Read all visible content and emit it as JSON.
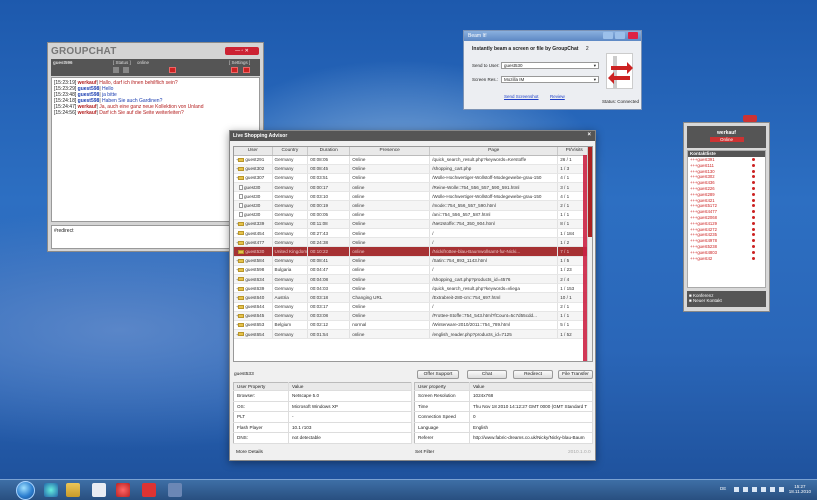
{
  "groupchat": {
    "logo": "GROUPCHAT",
    "user": "guest596",
    "status_label": "[ Status ]",
    "status_value": "online",
    "settings_label": "[ Settings ]",
    "log": [
      {
        "ts": "[15:23:19]",
        "name": "werkauf",
        "sep": "|",
        "msg": "Hallo, darf ich ihnen behilflich sein?",
        "color": "#b42020"
      },
      {
        "ts": "[15:23:29]",
        "name": "guest598",
        "sep": "|",
        "msg": "Hello",
        "color": "#1a3cb0"
      },
      {
        "ts": "[15:23:48]",
        "name": "guest598",
        "sep": "|",
        "msg": "ja bitte",
        "color": "#1a3cb0"
      },
      {
        "ts": "[15:24:18]",
        "name": "guest598",
        "sep": "|",
        "msg": "Haben Sie auch Gardinen?",
        "color": "#1a3cb0"
      },
      {
        "ts": "[15:24:47]",
        "name": "werkauf",
        "sep": "|",
        "msg": "Ja, auch eine ganz neue Kollektion von Unland",
        "color": "#b42020"
      },
      {
        "ts": "[15:24:56]",
        "name": "werkauf",
        "sep": "|",
        "msg": "Darf ich Sie auf die Seite weiterleiten?",
        "color": "#b42020"
      }
    ],
    "input_value": "#redirect"
  },
  "beam": {
    "title": "Beam It!",
    "heading": "Instantly beam a screen or file by GroupChat",
    "heading_num": "2",
    "send_label": "Send to User:",
    "send_value": "guest530",
    "screen_label": "Screen Res.:",
    "screen_value": "Mozilla IM",
    "send_link": "Send Screenshot",
    "review_link": "Review",
    "status": "Status: Connected"
  },
  "contacts": {
    "user": "werkauf",
    "status": "Online",
    "list_header": "Kontaktliste",
    "items": [
      "+++guest391",
      "+++guest111",
      "+++guest130",
      "+++guest302",
      "+++guest436",
      "+++guest226",
      "+++guest289",
      "+++guest421",
      "+++guest5172",
      "+++guest4477",
      "+++guest2068",
      "+++guest4129",
      "+++guest4272",
      "+++guest4235",
      "+++guest4978",
      "+++guest5238",
      "+++guest4803",
      "+++guest42"
    ],
    "foot1": "Konferenz",
    "foot2": "Neuer Kontakt"
  },
  "advisor": {
    "title": "Live Shopping Advisor",
    "close": "×",
    "columns": [
      "User",
      "Country",
      "Duration",
      "Presence",
      "Page",
      "PI/Visits"
    ],
    "rows": [
      {
        "icon": "folder",
        "user": "guest291",
        "country": "Germany",
        "duration": "00:08:05",
        "presence": "Online",
        "page": "/quick_search_result.php?keywords=Kerstoffe",
        "pi": "26 / 1"
      },
      {
        "icon": "folder",
        "user": "guest302",
        "country": "Germany",
        "duration": "00:08:45",
        "presence": "Online",
        "page": "/shopping_cart.php",
        "pi": "1 / 3"
      },
      {
        "icon": "folder",
        "user": "guest307",
        "country": "Germany",
        "duration": "00:03:51",
        "presence": "Online",
        "page": "/Wolle-Hochwertiger-Wollstoff-Modegewebe-grau-150",
        "pi": "4 / 1"
      },
      {
        "icon": "doc",
        "user": "guest30",
        "country": "Germany",
        "duration": "00:00:17",
        "presence": "online",
        "page": "/Reine-Wolle::754_556_557_590_591.html",
        "pi": "3 / 1"
      },
      {
        "icon": "doc",
        "user": "guest30",
        "country": "Germany",
        "duration": "00:03:10",
        "presence": "online",
        "page": "/Wolle-Hochwertiger-Wollstoff-Modegewebe-grau-150",
        "pi": "4 / 1"
      },
      {
        "icon": "doc",
        "user": "guest30",
        "country": "Germany",
        "duration": "00:00:19",
        "presence": "online",
        "page": "/mode::754_556_557_590.html",
        "pi": "2 / 1"
      },
      {
        "icon": "doc",
        "user": "guest30",
        "country": "Germany",
        "duration": "00:00:05",
        "presence": "online",
        "page": "/ani::754_556_557_587.html",
        "pi": "1 / 1"
      },
      {
        "icon": "folder",
        "user": "guest339",
        "country": "Germany",
        "duration": "00:11:08",
        "presence": "Online",
        "page": "/Netzstoffe::754_350_904.html",
        "pi": "8 / 1"
      },
      {
        "icon": "folder",
        "user": "guest454",
        "country": "Germany",
        "duration": "00:27:43",
        "presence": "Online",
        "page": "/",
        "pi": "1 / 184"
      },
      {
        "icon": "folder",
        "user": "guest477",
        "country": "Germany",
        "duration": "00:24:38",
        "presence": "Online",
        "page": "/",
        "pi": "1 / 2"
      },
      {
        "icon": "folder",
        "user": "guest530",
        "country": "United Kingdom",
        "duration": "00:10:22",
        "presence": "online",
        "page": "/Nickifrottee-blau-Baumwollsamt-fur-Nicki...",
        "pi": "7 / 1",
        "selected": true
      },
      {
        "icon": "folder",
        "user": "guest584",
        "country": "Germany",
        "duration": "00:08:41",
        "presence": "Online",
        "page": "/Satin::754_893_1143.html",
        "pi": "1 / 5"
      },
      {
        "icon": "folder",
        "user": "guest598",
        "country": "Bulgaria",
        "duration": "00:04:47",
        "presence": "online",
        "page": "/",
        "pi": "1 / 23"
      },
      {
        "icon": "folder",
        "user": "guest634",
        "country": "Germany",
        "duration": "00:04:08",
        "presence": "Online",
        "page": "/shopping_cart.php?products_id=4576",
        "pi": "2 / 4"
      },
      {
        "icon": "folder",
        "user": "guest639",
        "country": "Germany",
        "duration": "00:04:03",
        "presence": "Online",
        "page": "/quick_search_result.php?keywords=vliega",
        "pi": "1 / 153"
      },
      {
        "icon": "folder",
        "user": "guest640",
        "country": "Austria",
        "duration": "00:03:18",
        "presence": "Changing URL",
        "page": "/Extrabreit-280-cm::754_697.html",
        "pi": "10 / 1"
      },
      {
        "icon": "folder",
        "user": "guest644",
        "country": "Germany",
        "duration": "00:03:17",
        "presence": "Online",
        "page": "/",
        "pi": "2 / 1"
      },
      {
        "icon": "folder",
        "user": "guest645",
        "country": "Germany",
        "duration": "00:03:08",
        "presence": "Online",
        "page": "/Frottee-Stoffe::754_543.html?fCount=5c7d55cdd...",
        "pi": "1 / 1"
      },
      {
        "icon": "folder",
        "user": "guest653",
        "country": "Belgium",
        "duration": "00:02:12",
        "presence": "normal",
        "page": "/Winterware-2010/2011::754_789.html",
        "pi": "5 / 1"
      },
      {
        "icon": "folder",
        "user": "guest654",
        "country": "Germany",
        "duration": "00:01:54",
        "presence": "online",
        "page": "/english_reader.php?products_id=7125",
        "pi": "1 / 52"
      }
    ],
    "selected_user": "guest533",
    "buttons": {
      "offer": "Offer Support",
      "chat": "Chat",
      "redirect": "Redirect",
      "file": "File Transfer"
    },
    "left_props": [
      [
        "User Property",
        "Value"
      ],
      [
        "Browser:",
        "Netscape 5.0"
      ],
      [
        "OS:",
        "Microsoft Windows XP"
      ],
      [
        "PLT",
        "-"
      ],
      [
        "Flash Player",
        "10.1 r103"
      ],
      [
        "DNS:",
        "not detectable"
      ]
    ],
    "right_props": [
      [
        "User property",
        "Value"
      ],
      [
        "Screen Resolution",
        "1024x768"
      ],
      [
        "Time",
        "Thu Nov 18 2010 14:12:27 GMT 0000 (GMT Standard T"
      ],
      [
        "Connection Speed",
        "0"
      ],
      [
        "Language",
        "English"
      ],
      [
        "Referer",
        "http://www.fabric-dreams.co.uk/Nicky/Nicky-blau-Baum"
      ]
    ],
    "more_details": "More Details",
    "set_filter": "Set Filter",
    "version": "2010.1.0.0"
  },
  "taskbar": {
    "time": "15:27",
    "date": "18.11.2010",
    "lang": "DE"
  }
}
